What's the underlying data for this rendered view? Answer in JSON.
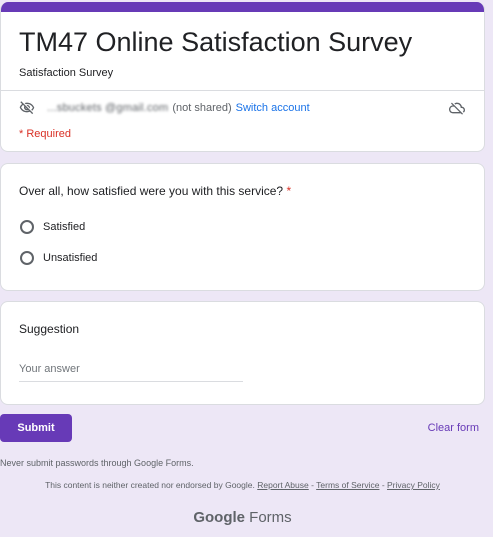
{
  "form": {
    "title": "TM47 Online Satisfaction Survey",
    "description": "Satisfaction Survey",
    "accent_color": "#673ab7"
  },
  "account": {
    "email": "...sbuckets   @gmail.com",
    "not_shared": "(not shared)",
    "switch_label": "Switch account"
  },
  "required_note": "* Required",
  "question": {
    "title": "Over all, how satisfied were you with this service?",
    "required_mark": "*",
    "options": [
      "Satisfied",
      "Unsatisfied"
    ]
  },
  "suggestion": {
    "title": "Suggestion",
    "placeholder": "Your answer"
  },
  "actions": {
    "submit": "Submit",
    "clear": "Clear form"
  },
  "footer": {
    "never_submit": "Never submit passwords through Google Forms.",
    "disclaimer": "This content is neither created nor endorsed by Google.",
    "report_abuse": "Report Abuse",
    "terms": "Terms of Service",
    "privacy": "Privacy Policy",
    "sep": " - ",
    "brand_google": "Google",
    "brand_forms": "Forms"
  }
}
